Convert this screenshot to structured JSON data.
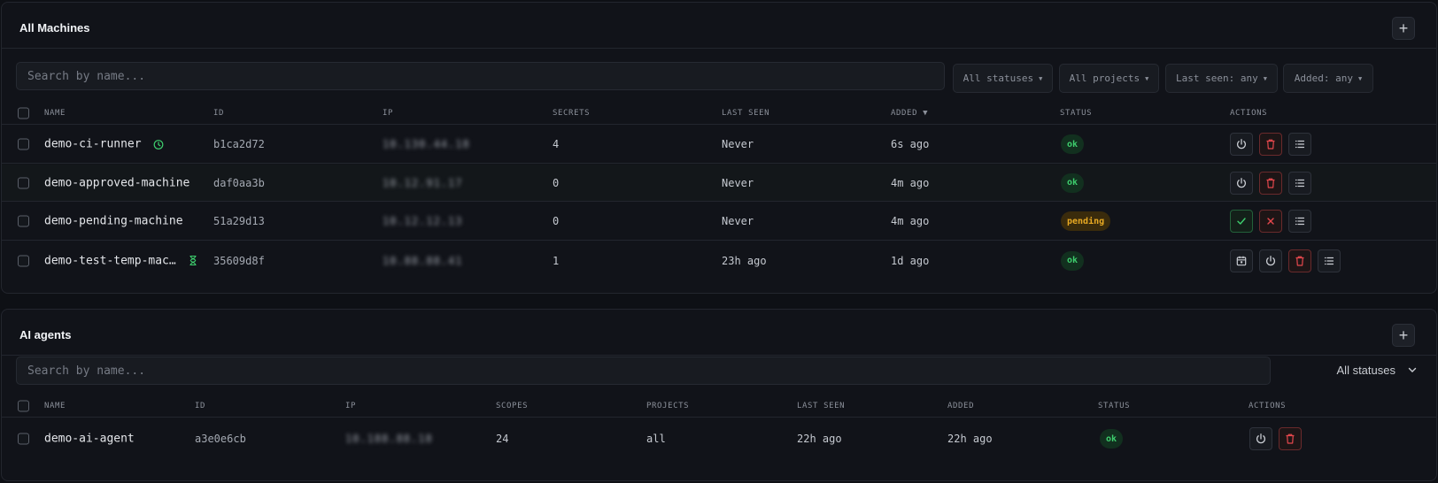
{
  "machines": {
    "title": "All Machines",
    "add_label": "+",
    "search_placeholder": "Search by name...",
    "filters": [
      "All statuses",
      "All projects",
      "Last seen: any",
      "Added: any"
    ],
    "columns": [
      "NAME",
      "ID",
      "IP",
      "SECRETS",
      "LAST SEEN",
      "ADDED ▼",
      "STATUS",
      "ACTIONS"
    ],
    "rows": [
      {
        "name": "demo-ci-runner",
        "id": "b1ca2d72",
        "ip": "10.130.44.18",
        "secrets": "4",
        "last_seen": "Never",
        "added": "6s ago",
        "status": "ok"
      },
      {
        "name": "demo-approved-machine",
        "id": "daf0aa3b",
        "ip": "10.12.91.17",
        "secrets": "0",
        "last_seen": "Never",
        "added": "4m ago",
        "status": "ok"
      },
      {
        "name": "demo-pending-machine",
        "id": "51a29d13",
        "ip": "10.12.12.13",
        "secrets": "0",
        "last_seen": "Never",
        "added": "4m ago",
        "status": "pending"
      },
      {
        "name": "demo-test-temp-mac…",
        "id": "35609d8f",
        "ip": "10.88.88.41",
        "secrets": "1",
        "last_seen": "23h ago",
        "added": "1d ago",
        "status": "ok"
      }
    ]
  },
  "agents": {
    "title": "AI agents",
    "add_label": "+",
    "search_placeholder": "Search by name...",
    "status_filter": "All statuses",
    "columns": [
      "NAME",
      "ID",
      "IP",
      "SCOPES",
      "PROJECTS",
      "LAST SEEN",
      "ADDED",
      "STATUS",
      "ACTIONS"
    ],
    "rows": [
      {
        "name": "demo-ai-agent",
        "id": "a3e0e6cb",
        "ip": "10.188.88.18",
        "scopes": "24",
        "projects": "all",
        "last_seen": "22h ago",
        "added": "22h ago",
        "status": "ok"
      }
    ]
  },
  "colors": {
    "ok": "#3ecf6e",
    "pending": "#e8a923",
    "danger": "#e5484d"
  },
  "icons": {
    "row1_name_icon": "clock-icon",
    "row4_name_icon": "hourglass-icon"
  }
}
